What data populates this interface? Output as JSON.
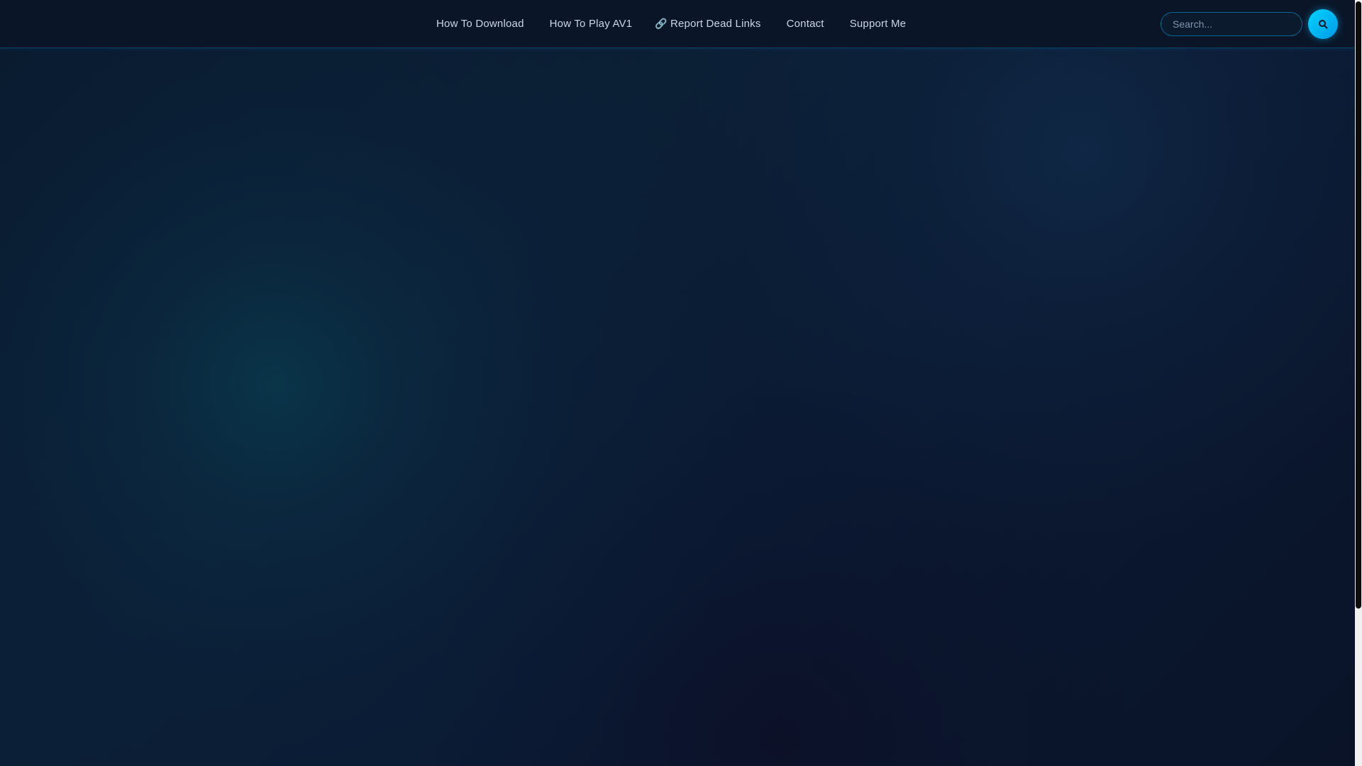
{
  "nav": {
    "items": [
      {
        "icon": "download-icon",
        "glyph": "",
        "label": "How To Download"
      },
      {
        "icon": "play-icon",
        "glyph": "",
        "label": "How To Play AV1"
      },
      {
        "icon": "link-icon",
        "glyph": "🔗",
        "label": "Report Dead Links"
      },
      {
        "icon": "envelope-icon",
        "glyph": "",
        "label": "Contact"
      },
      {
        "icon": "heart-icon",
        "glyph": "",
        "label": "Support Me"
      }
    ]
  },
  "search": {
    "placeholder": "Search...",
    "value": "",
    "button_icon": "search-icon"
  },
  "colors": {
    "background": "#0b1a2e",
    "navbar": "#0a1628",
    "nav_text": "#c9d6e6",
    "accent": "#00b8f0"
  }
}
